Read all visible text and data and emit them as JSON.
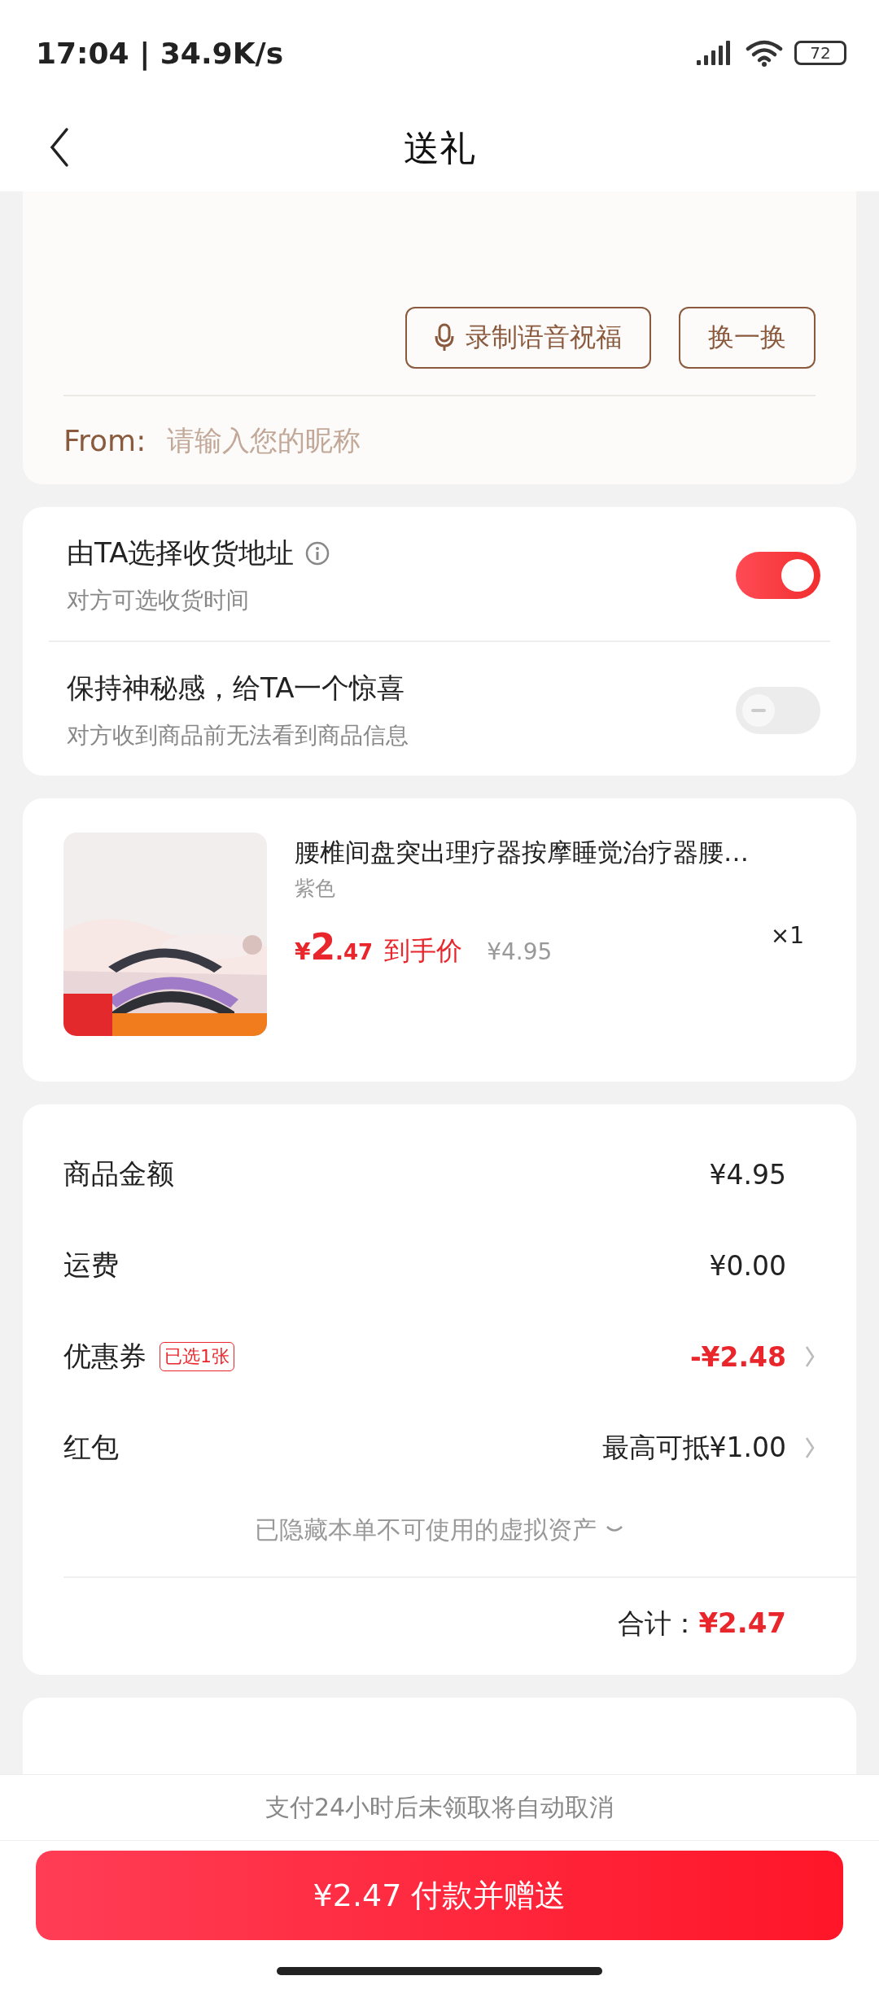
{
  "status_bar": {
    "time": "17:04 | 34.9K/s",
    "battery": "72"
  },
  "nav": {
    "title": "送礼"
  },
  "greeting": {
    "buttons": [
      {
        "kind": "voice",
        "label": "录制语音祝福"
      },
      {
        "kind": "plain",
        "label": "换一换"
      }
    ],
    "from_label": "From:",
    "from_placeholder": "请输入您的昵称"
  },
  "options": [
    {
      "title": "由TA选择收货地址",
      "info": true,
      "subtitle": "对方可选收货时间",
      "on": true
    },
    {
      "title": "保持神秘感，给TA一个惊喜",
      "info": false,
      "subtitle": "对方收到商品前无法看到商品信息",
      "on": false
    }
  ],
  "product": {
    "kind": "picture",
    "title": "腰椎间盘突出理疗器按摩睡觉治疗器腰…",
    "variant": "紫色",
    "currency": "¥",
    "price_int": "2",
    "price_dec": ".47",
    "price_tag": "到手价",
    "original_price": "¥4.95",
    "quantity": "×1"
  },
  "fees": {
    "rows": [
      {
        "label": "商品金额",
        "value": "¥4.95",
        "highlight": false,
        "link": false
      },
      {
        "label": "运费",
        "value": "¥0.00",
        "highlight": false,
        "link": false
      },
      {
        "label": "优惠券",
        "tag": "已选1张",
        "value": "-¥2.48",
        "highlight": true,
        "link": true
      },
      {
        "label": "红包",
        "value": "最高可抵¥1.00",
        "highlight": false,
        "link": true
      }
    ],
    "hidden_note": "已隐藏本单不可使用的虚拟资产",
    "total_label": "合计：",
    "total": "¥2.47"
  },
  "notice": "支付24小时后未领取将自动取消",
  "pay_button": "¥2.47 付款并赠送"
}
